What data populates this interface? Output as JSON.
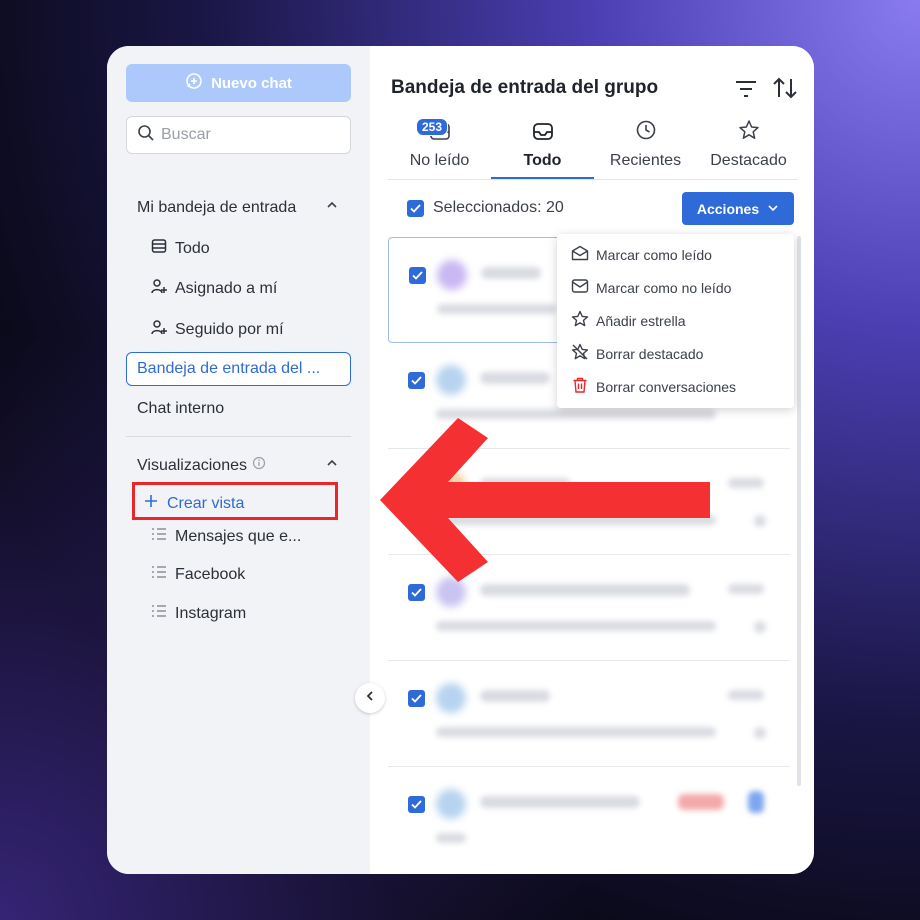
{
  "sidebar": {
    "new_chat_label": "Nuevo chat",
    "search_placeholder": "Buscar",
    "my_inbox": {
      "label": "Mi bandeja de entrada",
      "items": [
        {
          "label": "Todo",
          "icon": "list-icon"
        },
        {
          "label": "Asignado a mí",
          "icon": "user-plus-icon"
        },
        {
          "label": "Seguido por mí",
          "icon": "user-plus-icon"
        }
      ]
    },
    "group_inbox_label": "Bandeja de entrada del ...",
    "internal_chat_label": "Chat interno",
    "views": {
      "label": "Visualizaciones",
      "create_view_label": "Crear vista",
      "items": [
        {
          "label": "Mensajes que e..."
        },
        {
          "label": "Facebook"
        },
        {
          "label": "Instagram"
        }
      ]
    }
  },
  "main": {
    "title": "Bandeja de entrada del grupo",
    "tabs": [
      {
        "label": "No leído",
        "badge": "253"
      },
      {
        "label": "Todo"
      },
      {
        "label": "Recientes"
      },
      {
        "label": "Destacado"
      }
    ],
    "active_tab": 1,
    "selected_label": "Seleccionados: 20",
    "actions_label": "Acciones",
    "actions_menu": [
      {
        "label": "Marcar como leído",
        "icon": "envelope-open-icon"
      },
      {
        "label": "Marcar como no leído",
        "icon": "envelope-icon"
      },
      {
        "label": "Añadir estrella",
        "icon": "star-icon"
      },
      {
        "label": "Borrar destacado",
        "icon": "star-off-icon"
      },
      {
        "label": "Borrar conversaciones",
        "icon": "trash-icon"
      }
    ]
  },
  "colors": {
    "accent": "#2f6bd8",
    "annotation_red": "#e8272b",
    "new_chat_bg": "#adc9fb"
  }
}
